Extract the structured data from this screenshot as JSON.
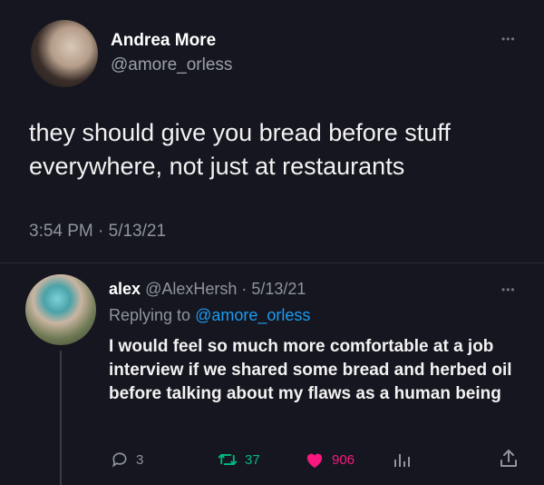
{
  "tweet": {
    "author_name": "Andrea More",
    "author_handle": "@amore_orless",
    "text": "they should give you bread before stuff everywhere, not just at restaurants",
    "timestamp": "3:54 PM · 5/13/21"
  },
  "reply": {
    "author_name": "alex",
    "author_handle": "@AlexHersh",
    "date": "· 5/13/21",
    "replying_prefix": "Replying to",
    "replying_mention": "@amore_orless",
    "text": "I would feel so much more comfortable at a job interview if we shared some bread and herbed oil before talking about my flaws as a human being",
    "actions": {
      "replies": "3",
      "retweets": "37",
      "likes": "906"
    }
  },
  "icons": {
    "more": "more-horizontal-icon",
    "reply": "reply-bubble-icon",
    "retweet": "retweet-icon",
    "like": "heart-icon",
    "analytics": "analytics-icon",
    "share": "share-icon"
  },
  "colors": {
    "background": "#15161f",
    "mention": "#1d9bf0",
    "retweet": "#00ba7c",
    "like": "#f91880",
    "muted": "#8f959b"
  }
}
